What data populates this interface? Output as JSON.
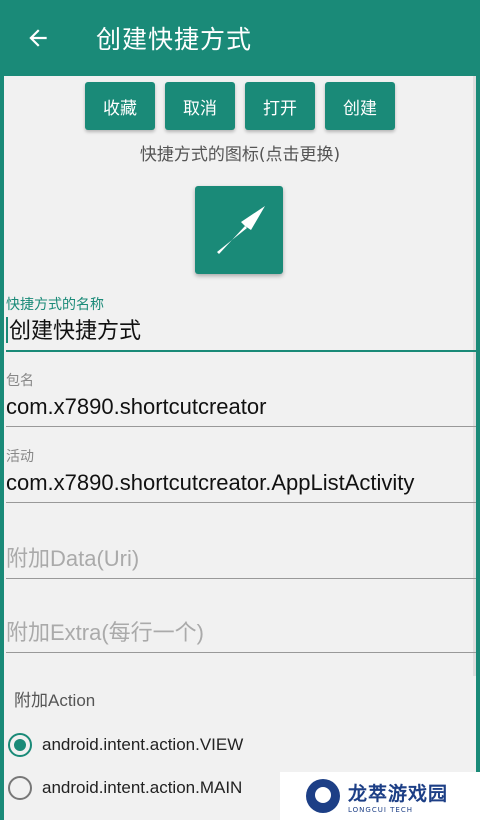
{
  "appbar": {
    "title": "创建快捷方式"
  },
  "buttons": {
    "favorite": "收藏",
    "cancel": "取消",
    "open": "打开",
    "create": "创建"
  },
  "icon_caption": "快捷方式的图标(点击更换)",
  "fields": {
    "name": {
      "label": "快捷方式的名称",
      "value": "创建快捷方式"
    },
    "package": {
      "label": "包名",
      "value": "com.x7890.shortcutcreator"
    },
    "activity": {
      "label": "活动",
      "value": "com.x7890.shortcutcreator.AppListActivity"
    },
    "data_uri": {
      "placeholder": "附加Data(Uri)"
    },
    "extra": {
      "placeholder": "附加Extra(每行一个)"
    }
  },
  "action_section": {
    "label": "附加Action",
    "options": [
      {
        "label": "android.intent.action.VIEW",
        "checked": true
      },
      {
        "label": "android.intent.action.MAIN",
        "checked": false
      }
    ]
  },
  "watermark": {
    "title": "龙萃游戏园",
    "subtitle": "LONGCUI TECH"
  },
  "colors": {
    "primary": "#1a8a78",
    "background": "#f1f1f1"
  },
  "icons": {
    "back": "arrow-left-icon",
    "shortcut": "arrow-up-right-icon"
  }
}
